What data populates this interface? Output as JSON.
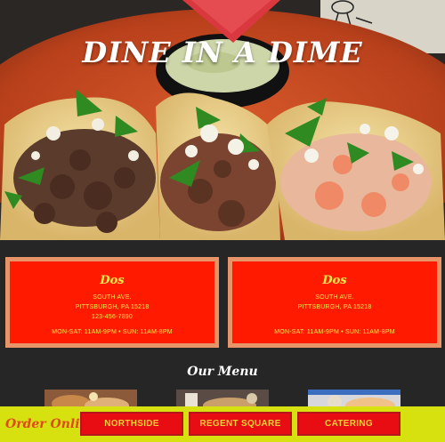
{
  "hero": {
    "title": "DINE IN A DIME"
  },
  "locations": [
    {
      "name": "Dos",
      "address": "SOUTH AVE.",
      "city": "PITTSBURGH, PA 15218",
      "phone": "123-456-7890",
      "hours": "MON-SAT: 11AM-9PM • SUN: 11AM-8PM"
    },
    {
      "name": "Dos",
      "address": "SOUTH AVE.",
      "city": "PITTSBURGH, PA 15218",
      "hours": "MON-SAT: 11AM-9PM • SUN: 11AM-8PM"
    }
  ],
  "menu": {
    "heading": "Our Menu"
  },
  "order_bar": {
    "label": "Order Online",
    "buttons": [
      "NORTHSIDE",
      "REGENT SQUARE",
      "CATERING"
    ]
  },
  "colors": {
    "card_red": "#ff1a00",
    "card_border": "#e79468",
    "card_text": "#f6e94a",
    "bar_yellow": "#d6e10f",
    "button_red": "#e80d12",
    "page_bg": "#262626"
  }
}
